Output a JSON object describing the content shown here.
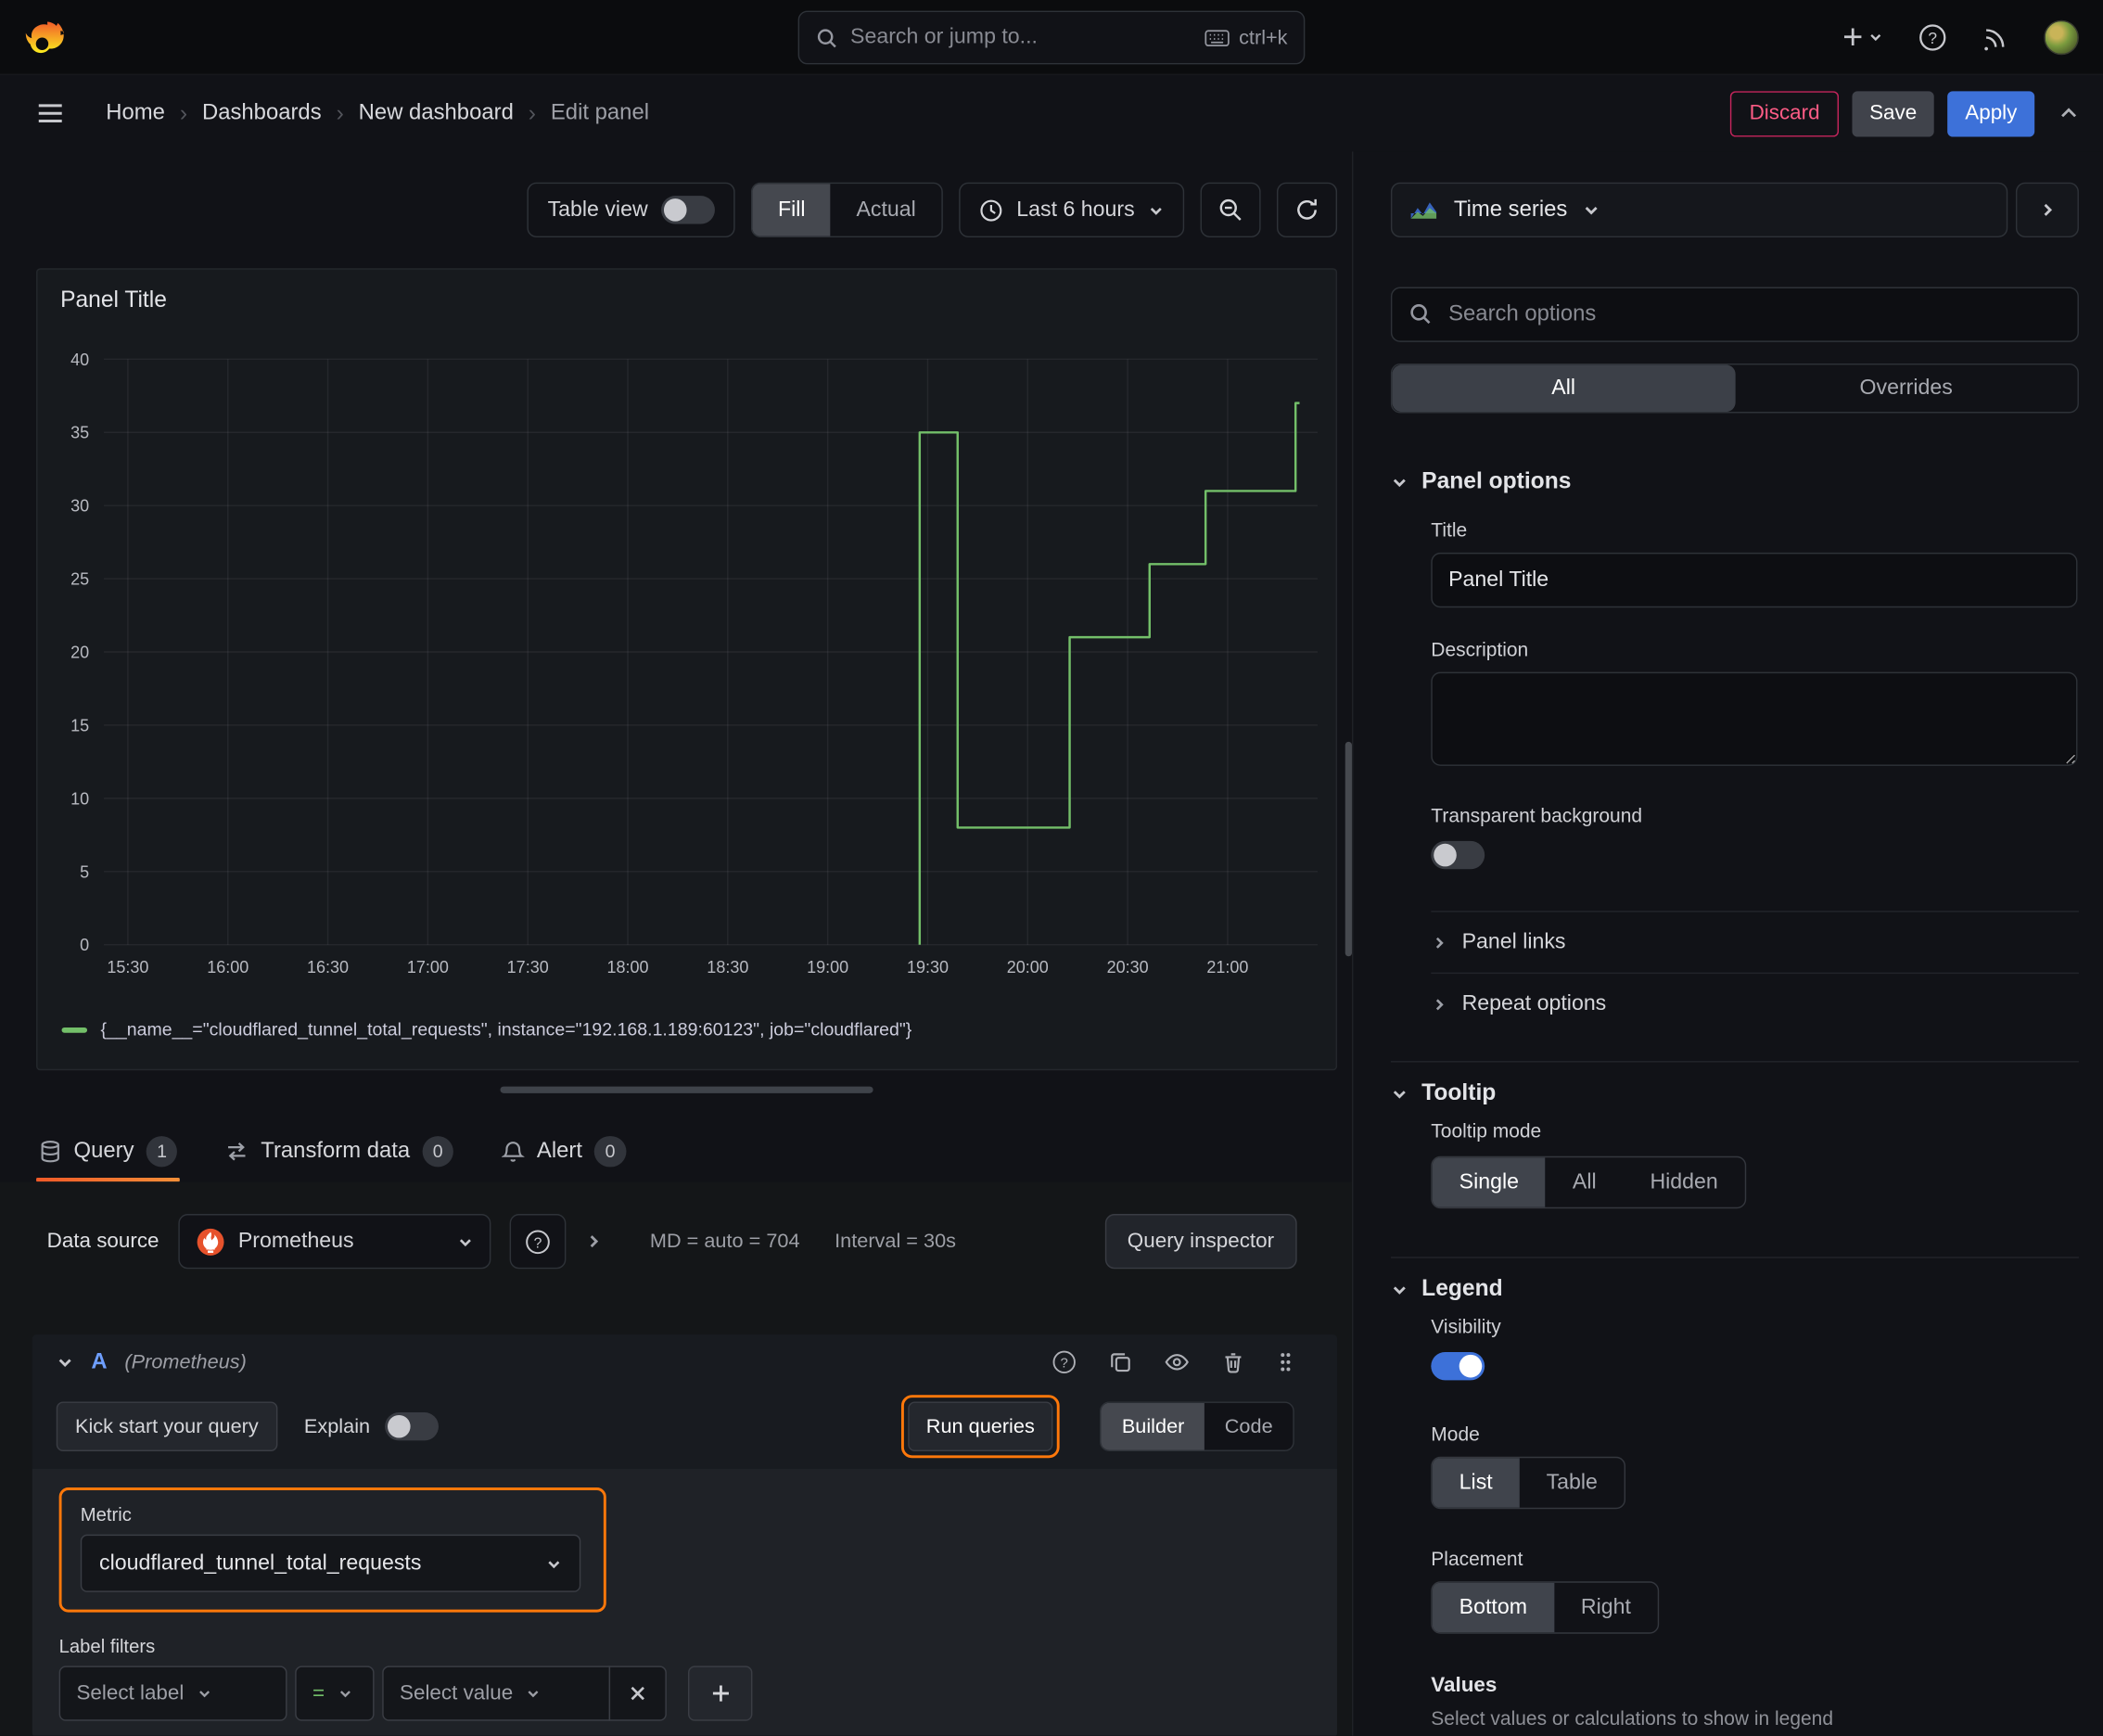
{
  "accent_colors": {
    "blue": "#3d71d9",
    "green": "#73bf69",
    "orange": "#ff780a",
    "red": "#e0226e"
  },
  "topnav": {
    "search_placeholder": "Search or jump to...",
    "search_shortcut": "ctrl+k"
  },
  "breadcrumb": {
    "items": [
      "Home",
      "Dashboards",
      "New dashboard",
      "Edit panel"
    ]
  },
  "header_actions": {
    "discard": "Discard",
    "save": "Save",
    "apply": "Apply"
  },
  "toolbar": {
    "table_view_label": "Table view",
    "fit_options": [
      "Fill",
      "Actual"
    ],
    "fit_selected": "Fill",
    "time_range": "Last 6 hours"
  },
  "panel": {
    "title": "Panel Title"
  },
  "chart_data": {
    "type": "line",
    "title": "Panel Title",
    "x_ticks": [
      "15:30",
      "16:00",
      "16:30",
      "17:00",
      "17:30",
      "18:00",
      "18:30",
      "19:00",
      "19:30",
      "20:00",
      "20:30",
      "21:00"
    ],
    "x_tick_hours": [
      15.5,
      16,
      16.5,
      17,
      17.5,
      18,
      18.5,
      19,
      19.5,
      20,
      20.5,
      21
    ],
    "x_range_hours": [
      15.38,
      21.45
    ],
    "y_ticks": [
      0,
      5,
      10,
      15,
      20,
      25,
      30,
      35,
      40
    ],
    "ylim": [
      0,
      40
    ],
    "grid": true,
    "legend_position": "bottom",
    "series": [
      {
        "name": "{__name__=\"cloudflared_tunnel_total_requests\", instance=\"192.168.1.189:60123\", job=\"cloudflared\"}",
        "color": "#73bf69",
        "step": true,
        "points": [
          [
            19.46,
            0
          ],
          [
            19.46,
            35
          ],
          [
            19.65,
            35
          ],
          [
            19.65,
            8
          ],
          [
            20.21,
            8
          ],
          [
            20.21,
            21
          ],
          [
            20.61,
            21
          ],
          [
            20.61,
            26
          ],
          [
            20.89,
            26
          ],
          [
            20.89,
            31
          ],
          [
            21.34,
            31
          ],
          [
            21.34,
            37
          ],
          [
            21.36,
            37
          ]
        ]
      }
    ]
  },
  "tabs": [
    {
      "label": "Query",
      "count": "1"
    },
    {
      "label": "Transform data",
      "count": "0"
    },
    {
      "label": "Alert",
      "count": "0"
    }
  ],
  "query": {
    "data_source_label": "Data source",
    "data_source": "Prometheus",
    "max_data_points": "MD = auto = 704",
    "interval": "Interval = 30s",
    "inspector": "Query inspector",
    "ref_id": "A",
    "ref_ds": "(Prometheus)",
    "kick_start": "Kick start your query",
    "explain": "Explain",
    "run": "Run queries",
    "editor_modes": [
      "Builder",
      "Code"
    ],
    "editor_mode_selected": "Builder",
    "metric_label": "Metric",
    "metric_value": "cloudflared_tunnel_total_requests",
    "label_filters": "Label filters",
    "select_label_placeholder": "Select label",
    "operator": "=",
    "select_value_placeholder": "Select value"
  },
  "options_pane": {
    "visualization": "Time series",
    "search_placeholder": "Search options",
    "filter_tabs": [
      "All",
      "Overrides"
    ],
    "filter_selected": "All",
    "panel_options": {
      "title": "Panel options",
      "title_label": "Title",
      "title_value": "Panel Title",
      "description_label": "Description",
      "transparent_label": "Transparent background",
      "links": "Panel links",
      "repeat": "Repeat options"
    },
    "tooltip": {
      "title": "Tooltip",
      "mode_label": "Tooltip mode",
      "modes": [
        "Single",
        "All",
        "Hidden"
      ],
      "mode_selected": "Single"
    },
    "legend": {
      "title": "Legend",
      "visibility_label": "Visibility",
      "visibility_on": true,
      "mode_label": "Mode",
      "modes": [
        "List",
        "Table"
      ],
      "mode_selected": "List",
      "placement_label": "Placement",
      "placements": [
        "Bottom",
        "Right"
      ],
      "placement_selected": "Bottom",
      "values_label": "Values",
      "values_desc": "Select values or calculations to show in legend"
    }
  }
}
